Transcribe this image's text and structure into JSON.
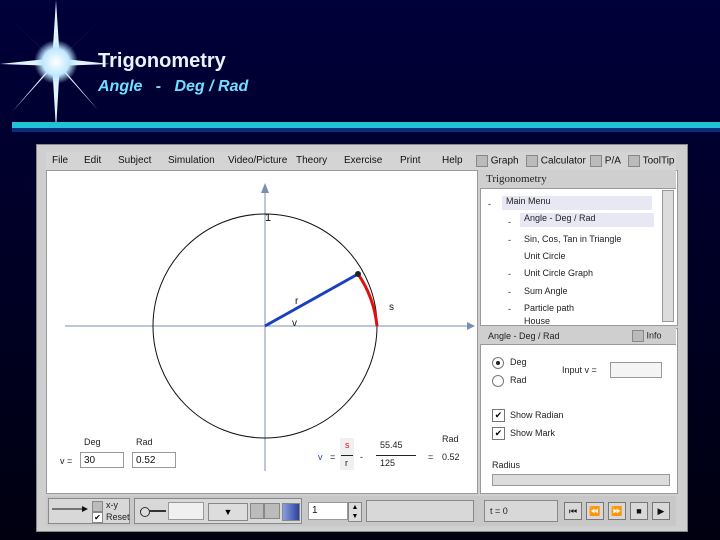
{
  "slide": {
    "title": "Trigonometry",
    "subtitle": "Angle   -   Deg / Rad"
  },
  "menu": {
    "items": [
      "File",
      "Edit",
      "Subject",
      "Simulation",
      "Video/Picture",
      "Theory",
      "Exercise",
      "Print",
      "Help"
    ],
    "toggles": [
      "Graph",
      "Calculator",
      "P/A",
      "ToolTip"
    ]
  },
  "canvas": {
    "label_1": "1",
    "label_r": "r",
    "label_s": "s",
    "label_v": "v"
  },
  "bottom_left": {
    "deg_label": "Deg",
    "rad_label": "Rad",
    "v_eq": "v =",
    "deg_value": "30",
    "rad_value": "0.52",
    "v_label": "v",
    "eq1": "=",
    "s": "s",
    "r": "r",
    "num": "55.45",
    "den": "125",
    "eq2": "=",
    "rad_label2": "Rad",
    "result": "0.52"
  },
  "tree": {
    "title": "Trigonometry",
    "items": [
      {
        "prefix": "-",
        "label": "Main Menu"
      },
      {
        "prefix": "-",
        "label": "Angle - Deg / Rad"
      },
      {
        "prefix": "-",
        "label": "Sin, Cos, Tan in Triangle"
      },
      {
        "prefix": "",
        "label": "Unit Circle"
      },
      {
        "prefix": "-",
        "label": "Unit Circle Graph"
      },
      {
        "prefix": "-",
        "label": "Sum Angle"
      },
      {
        "prefix": "-",
        "label": "Particle path"
      },
      {
        "prefix": "",
        "label": "House"
      }
    ]
  },
  "props": {
    "title": "Angle - Deg / Rad",
    "info": "Info",
    "radio_deg": "Deg",
    "radio_rad": "Rad",
    "input_label": "Input v =",
    "show_radian": "Show Radian",
    "show_mark": "Show Mark",
    "radius": "Radius",
    "selected_unit": "Deg"
  },
  "toolbar": {
    "xy": "x-y",
    "reset": "Reset",
    "step": "1",
    "t_display": "t = 0"
  },
  "colors": {
    "angle_line": "#1a3fbf",
    "arc": "#e01010",
    "accent": "#22c3d6"
  }
}
